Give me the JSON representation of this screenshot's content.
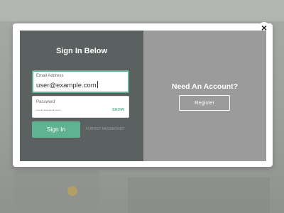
{
  "modal": {
    "close_glyph": "×",
    "login": {
      "title": "Sign In Below",
      "email": {
        "label": "Email Address",
        "value": "user@example.com"
      },
      "password": {
        "label": "Password",
        "masked_value": "••••••••••••••••",
        "show_label": "SHOW"
      },
      "signin_label": "Sign In",
      "forgot_label": "FORGOT PASSWORD?"
    },
    "register": {
      "heading": "Need An Account?",
      "button_label": "Register"
    }
  },
  "colors": {
    "accent": "#5fb392",
    "left_panel": "#5a6160",
    "right_panel": "#9b9b9b"
  }
}
